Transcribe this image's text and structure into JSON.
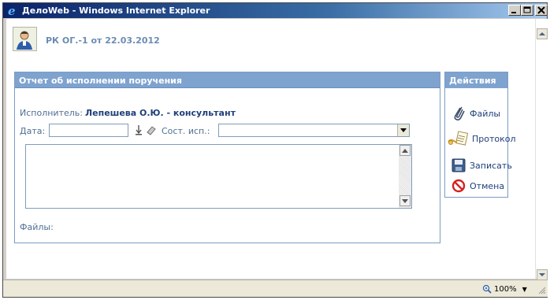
{
  "window": {
    "title": "ДелоWeb - Windows Internet Explorer",
    "min_glyph": "_",
    "close_glyph": "X"
  },
  "document": {
    "title": "РК ОГ.-1 от 22.03.2012"
  },
  "report_panel": {
    "title": "Отчет об исполнении поручения",
    "executor_label": "Исполнитель:",
    "executor_name": "Лепешева О.Ю. - консультант",
    "date_label": "Дата:",
    "date_value": "",
    "status_label": "Сост. исп.:",
    "status_value": "",
    "text_value": "",
    "files_label": "Файлы:"
  },
  "actions_panel": {
    "title": "Действия",
    "items": [
      {
        "label": "Файлы",
        "icon": "paperclip-icon"
      },
      {
        "label": "Протокол",
        "icon": "protocol-icon"
      },
      {
        "label": "Записать",
        "icon": "floppy-disk-icon"
      },
      {
        "label": "Отмена",
        "icon": "cancel-icon"
      }
    ]
  },
  "statusbar": {
    "zoom": "100%"
  },
  "colors": {
    "panel_header": "#7fa3cf",
    "title_text": "#6b8cb3",
    "link_text": "#1e3f7a",
    "cancel_red": "#d62020"
  }
}
